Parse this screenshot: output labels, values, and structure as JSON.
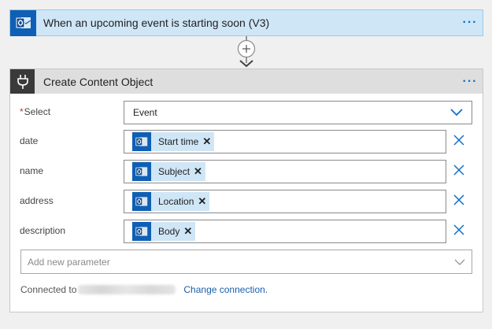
{
  "trigger": {
    "title": "When an upcoming event is starting soon (V3)",
    "menu": "···",
    "icon": "outlook-icon"
  },
  "action": {
    "title": "Create Content Object",
    "menu": "···",
    "icon": "plug-icon",
    "select": {
      "required_mark": "*",
      "label": "Select",
      "value": "Event"
    },
    "params": [
      {
        "label": "date",
        "token": "Start time"
      },
      {
        "label": "name",
        "token": "Subject"
      },
      {
        "label": "address",
        "token": "Location"
      },
      {
        "label": "description",
        "token": "Body"
      }
    ],
    "add_parameter_placeholder": "Add new parameter",
    "connected_prefix": "Connected to",
    "change_connection": "Change connection."
  },
  "colors": {
    "accent": "#0f5fb5",
    "trigger_bg": "#cfe6f7",
    "remove_x": "#1070c8"
  }
}
